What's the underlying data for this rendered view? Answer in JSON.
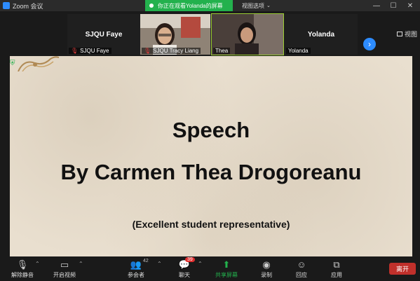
{
  "window": {
    "title": "Zoom 会议",
    "controls": [
      "—",
      "☐",
      "✕"
    ]
  },
  "share_banner": {
    "text": "你正在观看Yolanda的屏幕",
    "view_options": "视图选项"
  },
  "strip": {
    "tiles": [
      {
        "name_big": "SJQU Faye",
        "label": "SJQU Faye",
        "muted": true,
        "video": false
      },
      {
        "label": "SJQU Tracy Liang",
        "muted": true,
        "video": true
      },
      {
        "label": "Thea",
        "muted": false,
        "video": true
      },
      {
        "name_big": "Yolanda",
        "label": "Yolanda",
        "muted": false,
        "video": false
      }
    ],
    "view_button": "视图"
  },
  "slide": {
    "title": "Speech",
    "subtitle": "By Carmen Thea Drogoreanu",
    "note": "(Excellent student representative)"
  },
  "toolbar": {
    "unmute": "解除静音",
    "start_video": "开启视频",
    "participants": "参会者",
    "participants_count": "42",
    "chat": "聊天",
    "chat_badge": "39",
    "share_screen": "共享屏幕",
    "record": "录制",
    "reactions": "回应",
    "apps": "应用",
    "leave": "离开"
  },
  "colors": {
    "accent_blue": "#2d8cff",
    "share_green": "#23b14d",
    "leave_red": "#c0302b",
    "slide_bg": "#e9dfcf"
  }
}
